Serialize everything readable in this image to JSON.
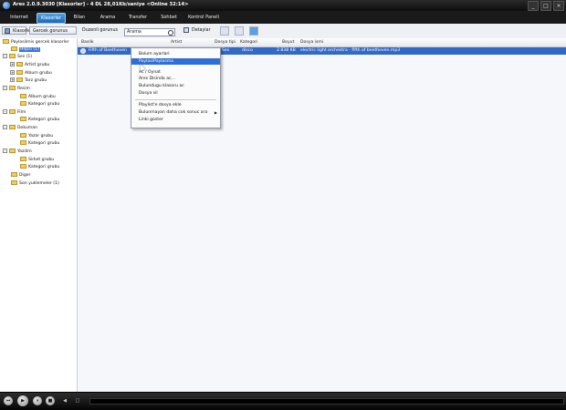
{
  "window": {
    "title": "Ares 2.0.9.3030  [Klasorler]   -  4 DL 28,01Kb/saniye   <Online 32:14>",
    "controls": {
      "minimize": "_",
      "maximize": "□",
      "close": "×"
    }
  },
  "nav": {
    "tabs": [
      {
        "label": "Internet"
      },
      {
        "label": "Klasorler"
      },
      {
        "label": "Bilan"
      },
      {
        "label": "Arama"
      },
      {
        "label": "Transfer"
      },
      {
        "label": "Sohbet"
      },
      {
        "label": "Kontrol Paneli"
      }
    ],
    "active": "Klasorler"
  },
  "toolbar": {
    "folders_label": "Klasorler",
    "actual_view_label": "Gercek gorunus",
    "edit_view_label": "Duzenli gorunus",
    "search_value": "Arama",
    "details_label": "Detaylar"
  },
  "tree": {
    "root": "Paylasilmis gercek klasorler",
    "items": [
      {
        "label": "Hepsi (1)"
      },
      {
        "label": "Ses (1)"
      },
      {
        "label": "Artist grubu"
      },
      {
        "label": "Album grubu"
      },
      {
        "label": "Tarz grubu"
      },
      {
        "label": "Resim"
      },
      {
        "label": "Album grubu"
      },
      {
        "label": "Kategori grubu"
      },
      {
        "label": "Film"
      },
      {
        "label": "Kategori grubu"
      },
      {
        "label": "Dokuman"
      },
      {
        "label": "Yazar grubu"
      },
      {
        "label": "Kategori grubu"
      },
      {
        "label": "Yazilim"
      },
      {
        "label": "Sirket grubu"
      },
      {
        "label": "Kategori grubu"
      },
      {
        "label": "Diger"
      },
      {
        "label": "Son yuklemeler (1)"
      }
    ]
  },
  "table": {
    "columns": [
      "Baslik",
      "Artist",
      "Dosya tipi",
      "Kategori",
      "Boyut",
      "Dosya ismi"
    ],
    "rows": [
      {
        "title": "Fifth of Beethoven",
        "artist": "",
        "type": "Ses",
        "category": "disco",
        "size": "2.838 KB",
        "filename": "electric light orchestra - fifth of beethoven.mp3"
      }
    ]
  },
  "context_menu": {
    "items": [
      {
        "label": "Bolum ayarlari"
      },
      {
        "label": "Paylas/Paylasma"
      },
      {
        "label": "Ac / Oynat"
      },
      {
        "label": "Ares Disinda ac..."
      },
      {
        "label": "Bulundugu klasoru ac"
      },
      {
        "label": "Dosya sil"
      },
      {
        "label": "Playlist'e dosya ekle"
      },
      {
        "label": "Bulunmayan daha cok sonuc ara"
      },
      {
        "label": "Linki goster"
      }
    ],
    "highlighted": "Paylas/Paylasma"
  },
  "player": {
    "play": "▶",
    "prev": "⏮",
    "stop": "■",
    "pause": "⏸"
  },
  "colors": {
    "accent": "#3169c6",
    "titlebar": "#111111",
    "folder": "#f2cf5b"
  }
}
